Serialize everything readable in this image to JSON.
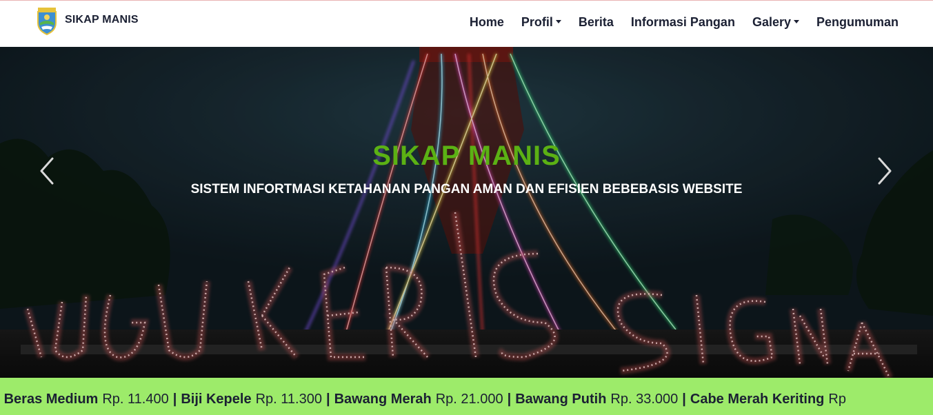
{
  "brand": {
    "name": "SIKAP MANIS"
  },
  "nav": {
    "items": [
      {
        "label": "Home",
        "dropdown": false
      },
      {
        "label": "Profil",
        "dropdown": true
      },
      {
        "label": "Berita",
        "dropdown": false
      },
      {
        "label": "Informasi Pangan",
        "dropdown": false
      },
      {
        "label": "Galery",
        "dropdown": true
      },
      {
        "label": "Pengumuman",
        "dropdown": false
      }
    ]
  },
  "hero": {
    "title": "SIKAP MANIS",
    "subtitle": "SISTEM INFORTMASI KETAHANAN PANGAN AMAN DAN EFISIEN BEBEBASIS WEBSITE",
    "sign_text": "TUGU KERIS SIGINJA",
    "colors": {
      "title": "#5bb114",
      "subtitle": "#ffffff"
    }
  },
  "ticker": {
    "leading": "|",
    "items": [
      {
        "name": "Beras Medium",
        "price": "Rp. 11.400"
      },
      {
        "name": "Biji Kepele",
        "price": "Rp. 11.300"
      },
      {
        "name": "Bawang Merah",
        "price": "Rp. 21.000"
      },
      {
        "name": "Bawang Putih",
        "price": "Rp. 33.000"
      },
      {
        "name": "Cabe Merah Keriting",
        "price": "Rp"
      }
    ],
    "background": "#9deb6a"
  }
}
